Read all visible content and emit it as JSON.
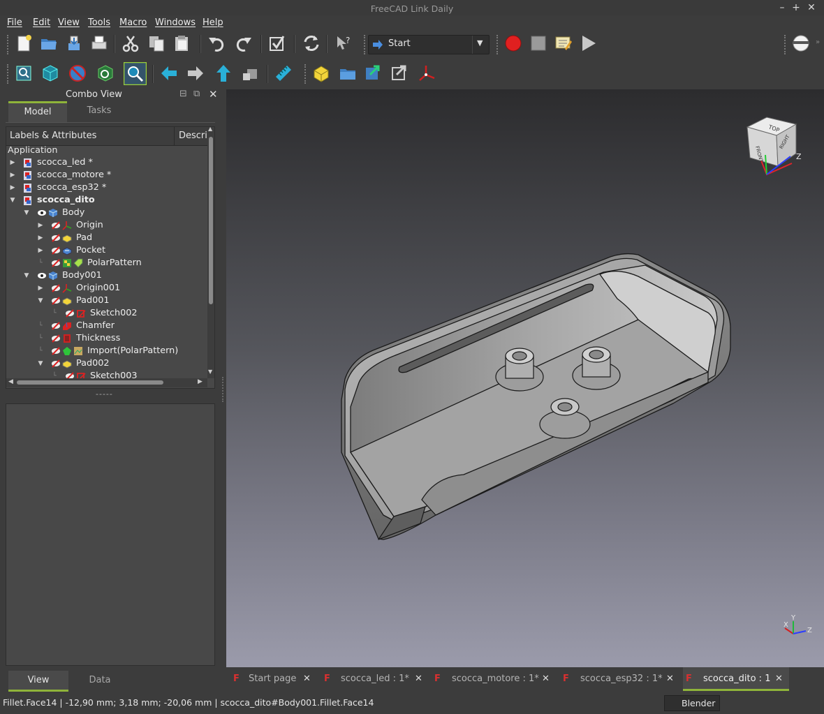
{
  "window": {
    "title": "FreeCAD Link Daily"
  },
  "menu": [
    "File",
    "Edit",
    "View",
    "Tools",
    "Macro",
    "Windows",
    "Help"
  ],
  "workbench": {
    "selected": "Start"
  },
  "combo_view": {
    "title": "Combo View",
    "tabs": [
      "Model",
      "Tasks"
    ],
    "active_tab": "Model",
    "columns": [
      "Labels & Attributes",
      "Descri"
    ],
    "application_label": "Application",
    "tree": [
      {
        "label": "scocca_led *",
        "level": 0,
        "expander": "closed",
        "icons": [
          "doc"
        ]
      },
      {
        "label": "scocca_motore *",
        "level": 0,
        "expander": "closed",
        "icons": [
          "doc"
        ]
      },
      {
        "label": "scocca_esp32 *",
        "level": 0,
        "expander": "closed",
        "icons": [
          "doc"
        ]
      },
      {
        "label": "scocca_dito",
        "level": 0,
        "expander": "open",
        "icons": [
          "doc"
        ],
        "bold": true
      },
      {
        "label": "Body",
        "level": 1,
        "expander": "open",
        "icons": [
          "eye",
          "body"
        ]
      },
      {
        "label": "Origin",
        "level": 2,
        "expander": "closed",
        "icons": [
          "hidden",
          "origin"
        ]
      },
      {
        "label": "Pad",
        "level": 2,
        "expander": "closed",
        "icons": [
          "hidden",
          "pad"
        ]
      },
      {
        "label": "Pocket",
        "level": 2,
        "expander": "closed",
        "icons": [
          "hidden",
          "pocket"
        ]
      },
      {
        "label": "PolarPattern",
        "level": 2,
        "expander": "none",
        "icons": [
          "hidden",
          "pattern",
          "tag"
        ]
      },
      {
        "label": "Body001",
        "level": 1,
        "expander": "open",
        "icons": [
          "eye",
          "body"
        ]
      },
      {
        "label": "Origin001",
        "level": 2,
        "expander": "closed",
        "icons": [
          "hidden",
          "origin"
        ]
      },
      {
        "label": "Pad001",
        "level": 2,
        "expander": "open",
        "icons": [
          "hidden",
          "pad"
        ]
      },
      {
        "label": "Sketch002",
        "level": 3,
        "expander": "none",
        "icons": [
          "hidden",
          "sketch"
        ]
      },
      {
        "label": "Chamfer",
        "level": 2,
        "expander": "none",
        "icons": [
          "hidden",
          "chamfer"
        ]
      },
      {
        "label": "Thickness",
        "level": 2,
        "expander": "none",
        "icons": [
          "hidden",
          "thickness"
        ]
      },
      {
        "label": "Import(PolarPattern)",
        "level": 2,
        "expander": "none",
        "icons": [
          "hidden",
          "import",
          "image"
        ]
      },
      {
        "label": "Pad002",
        "level": 2,
        "expander": "open",
        "icons": [
          "hidden",
          "pad"
        ]
      },
      {
        "label": "Sketch003",
        "level": 3,
        "expander": "none",
        "icons": [
          "hidden",
          "sketch"
        ]
      }
    ],
    "bottom_tabs": [
      "View",
      "Data"
    ],
    "active_bottom_tab": "View",
    "splitter": "-----"
  },
  "nav_cube": {
    "faces": [
      "TOP",
      "RIGHT",
      "FRONT"
    ],
    "axis_z": "Z"
  },
  "axis_triad": {
    "x": "X",
    "y": "Y",
    "z": "Z"
  },
  "doc_tabs": [
    {
      "label": "Start page",
      "active": false
    },
    {
      "label": "scocca_led : 1*",
      "active": false
    },
    {
      "label": "scocca_motore : 1*",
      "active": false
    },
    {
      "label": "scocca_esp32 : 1*",
      "active": false
    },
    {
      "label": "scocca_dito : 1",
      "active": true
    }
  ],
  "status": {
    "text": "Fillet.Face14 | -12,90 mm; 3,18 mm; -20,06 mm | scocca_dito#Body001.Fillet.Face14",
    "nav_style": "Blender"
  },
  "colors": {
    "accent": "#8fb43a",
    "record": "#e02020",
    "nav_arrow": "#2ab0d8"
  }
}
